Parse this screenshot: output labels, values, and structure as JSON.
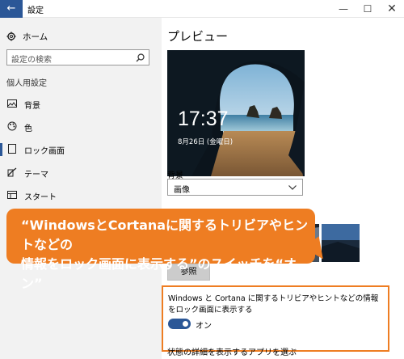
{
  "window": {
    "title": "設定",
    "back_glyph": "←",
    "minimize_glyph": "—",
    "maximize_glyph": "☐",
    "close_glyph": "✕"
  },
  "sidebar": {
    "home_label": "ホーム",
    "search_placeholder": "設定の検索",
    "section_label": "個人用設定",
    "items": [
      {
        "label": "背景",
        "icon": "image-icon"
      },
      {
        "label": "色",
        "icon": "palette-icon"
      },
      {
        "label": "ロック画面",
        "icon": "lock-screen-icon",
        "selected": true
      },
      {
        "label": "テーマ",
        "icon": "theme-icon"
      },
      {
        "label": "スタート",
        "icon": "start-icon"
      }
    ]
  },
  "main": {
    "preview_title": "プレビュー",
    "preview_time": "17:37",
    "preview_date": "8月26日 (金曜日)",
    "background_label": "背景",
    "background_value": "画像",
    "browse_label": "参照",
    "toggle_text": "Windows と Cortana に関するトリビアやヒントなどの情報をロック画面に表示する",
    "toggle_state": "オン",
    "toggle_on": true,
    "detail_label": "状態の詳細を表示するアプリを選ぶ"
  },
  "callout": {
    "line1": "“WindowsとCortanaに関するトリビアやヒントなどの",
    "line2": "情報をロック画面に表示する”のスイッチを“オン”"
  },
  "colors": {
    "accent": "#2b5797",
    "callout": "#ee7d22",
    "sidebar_bg": "#f2f2f2"
  }
}
